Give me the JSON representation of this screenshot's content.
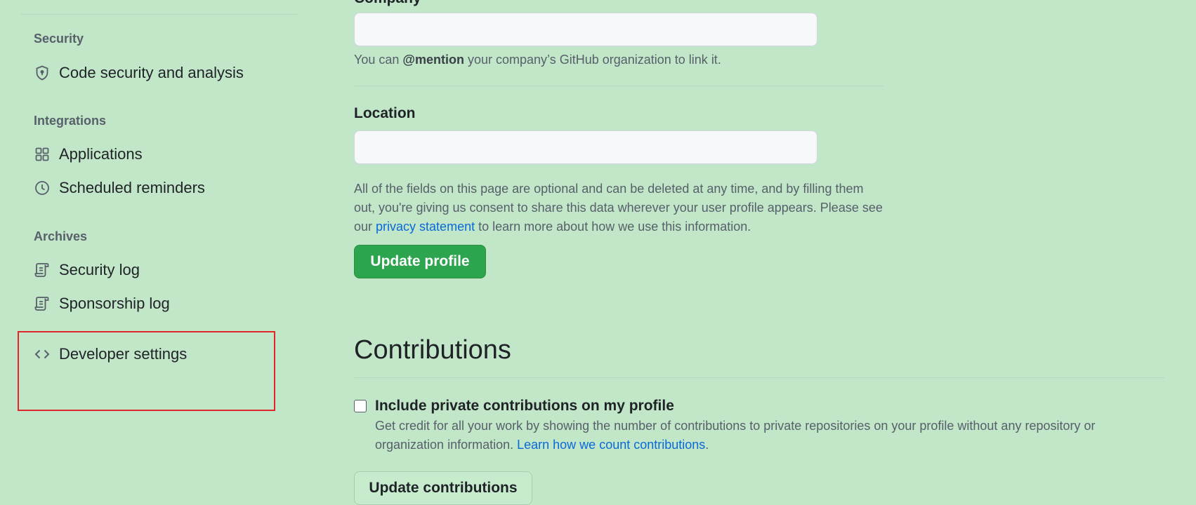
{
  "sidebar": {
    "sections": [
      {
        "header": "Security",
        "items": [
          {
            "label": "Code security and analysis",
            "icon": "shield-lock-icon"
          }
        ]
      },
      {
        "header": "Integrations",
        "items": [
          {
            "label": "Applications",
            "icon": "apps-grid-icon"
          },
          {
            "label": "Scheduled reminders",
            "icon": "clock-icon"
          }
        ]
      },
      {
        "header": "Archives",
        "items": [
          {
            "label": "Security log",
            "icon": "log-icon"
          },
          {
            "label": "Sponsorship log",
            "icon": "log-icon"
          }
        ]
      }
    ],
    "developer_settings": {
      "label": "Developer settings",
      "icon": "code-icon"
    }
  },
  "highlight_color": "#e0262b",
  "profile_form": {
    "company": {
      "label": "Company",
      "value": "",
      "hint_prefix": "You can ",
      "hint_mention": "@mention",
      "hint_suffix": " your company’s GitHub organization to link it."
    },
    "location": {
      "label": "Location",
      "value": ""
    },
    "notice": {
      "text_before": "All of the fields on this page are optional and can be deleted at any time, and by filling them out, you're giving us consent to share this data wherever your user profile appears. Please see our ",
      "link": "privacy statement",
      "text_after": " to learn more about how we use this information."
    },
    "update_button": "Update profile"
  },
  "contributions": {
    "title": "Contributions",
    "checkbox_label": "Include private contributions on my profile",
    "checked": false,
    "description_before": "Get credit for all your work by showing the number of contributions to private repositories on your profile without any repository or organization information. ",
    "description_link": "Learn how we count contributions",
    "description_after": ".",
    "update_button": "Update contributions"
  },
  "colors": {
    "background": "#c2e6c8",
    "primary_button": "#2da44e",
    "link": "#0969da"
  }
}
